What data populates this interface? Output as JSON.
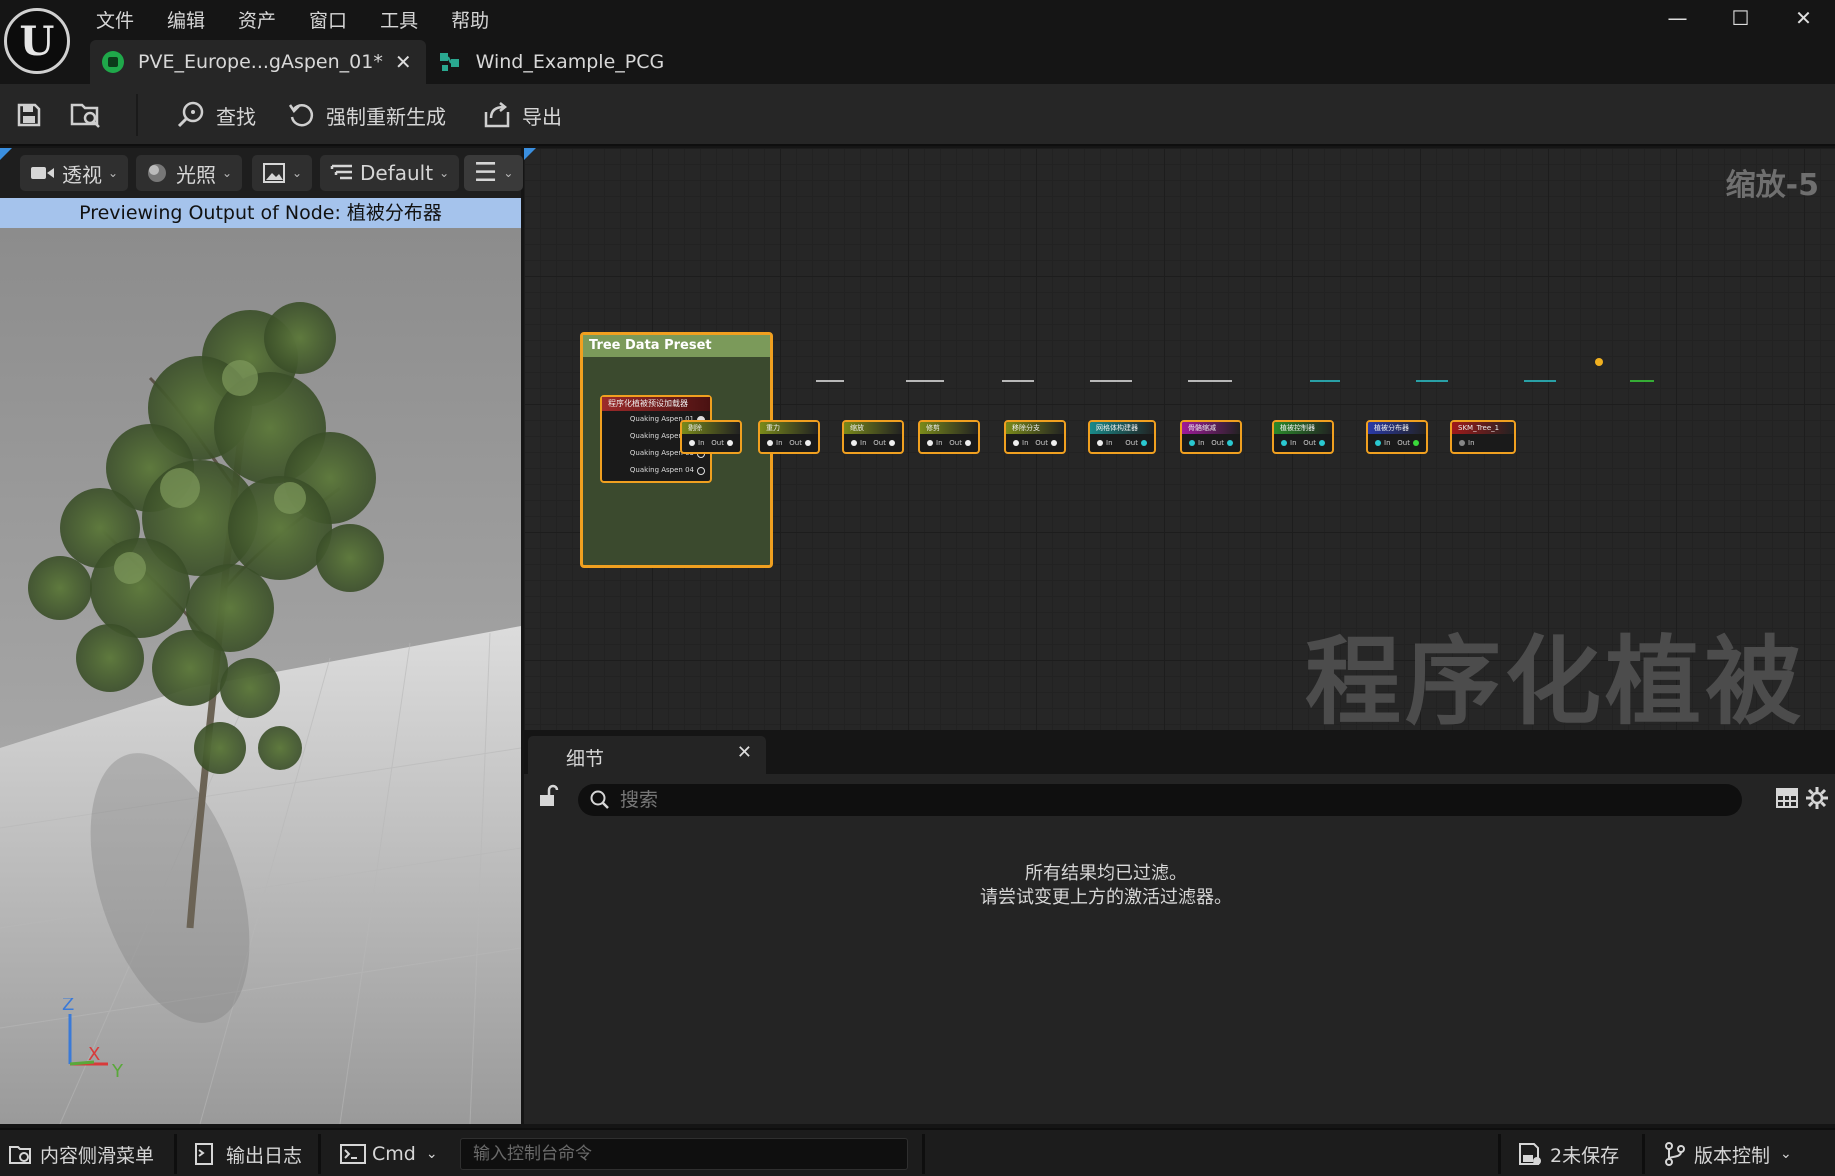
{
  "menu": [
    "文件",
    "编辑",
    "资产",
    "窗口",
    "工具",
    "帮助"
  ],
  "tabs": [
    {
      "label": "PVE_Europe...gAspen_01*",
      "active": true
    },
    {
      "label": "Wind_Example_PCG",
      "active": false
    }
  ],
  "toolbar": {
    "find": "查找",
    "regenerate": "强制重新生成",
    "export": "导出"
  },
  "viewport": {
    "perspective": "透视",
    "lighting": "光照",
    "default": "Default",
    "banner": "Previewing Output of Node: 植被分布器",
    "axes": {
      "z": "Z",
      "x": "X",
      "y": "Y"
    }
  },
  "graph": {
    "zoom": "缩放-5",
    "watermark": "程序化植被",
    "comment_title": "Tree Data Preset",
    "loader_title": "程序化植被预设加载器",
    "loader_outputs": [
      "Quaking Aspen 01",
      "Quaking Aspen 02",
      "Quaking Aspen 03",
      "Quaking Aspen 04"
    ],
    "pin_in": "In",
    "pin_out": "Out",
    "nodes": [
      {
        "title": "剔除",
        "color": "#7a8a1a"
      },
      {
        "title": "重力",
        "color": "#7a8a1a"
      },
      {
        "title": "缩放",
        "color": "#7a8a1a"
      },
      {
        "title": "修剪",
        "color": "#7a8a1a"
      },
      {
        "title": "移除分支",
        "color": "#7a8a1a"
      },
      {
        "title": "网格体构建器",
        "color": "#1a8a8a"
      },
      {
        "title": "骨骼缩减",
        "color": "#a01a9a"
      },
      {
        "title": "植被控制器",
        "color": "#2a8a2a"
      },
      {
        "title": "植被分布器",
        "color": "#2a3aa8"
      },
      {
        "title": "SKM_Tree_1",
        "color": "#a01a1a"
      }
    ]
  },
  "details": {
    "tab": "细节",
    "search_placeholder": "搜索",
    "msg_line1": "所有结果均已过滤。",
    "msg_line2": "请尝试变更上方的激活过滤器。"
  },
  "statusbar": {
    "content_drawer": "内容侧滑菜单",
    "output_log": "输出日志",
    "cmd": "Cmd",
    "cmd_placeholder": "输入控制台命令",
    "unsaved": "2未保存",
    "source_control": "版本控制"
  }
}
